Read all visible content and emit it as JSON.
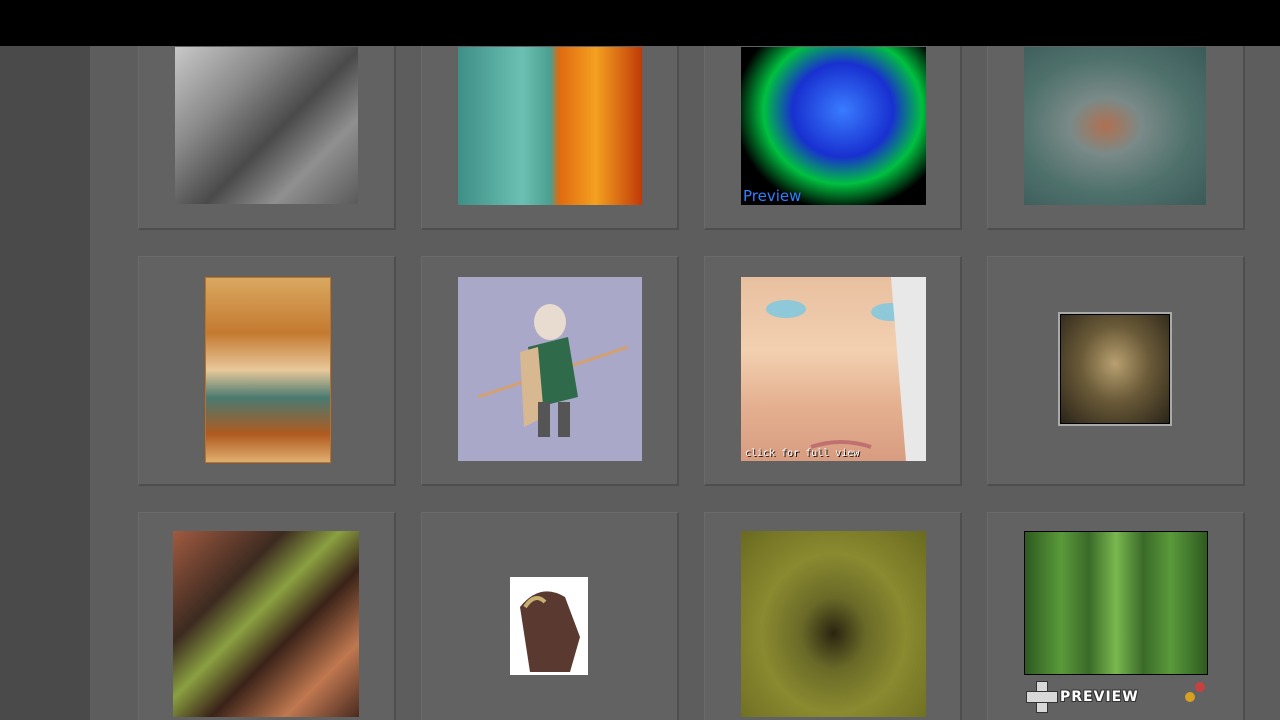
{
  "gallery": {
    "items": [
      {
        "name": "stone-giant-artwork",
        "caption": ""
      },
      {
        "name": "ice-fire-faces-artwork",
        "caption": ""
      },
      {
        "name": "ansi-helmet-artwork",
        "caption": "Preview"
      },
      {
        "name": "viking-ship-artwork",
        "caption": ""
      },
      {
        "name": "tower-map-artwork",
        "caption": ""
      },
      {
        "name": "spear-warrior-artwork",
        "caption": ""
      },
      {
        "name": "woman-face-artwork",
        "caption": "click for full view"
      },
      {
        "name": "skull-totem-artwork",
        "caption": ""
      },
      {
        "name": "jungle-vines-artwork",
        "caption": ""
      },
      {
        "name": "claw-hand-artwork",
        "caption": ""
      },
      {
        "name": "green-eye-artwork",
        "caption": ""
      },
      {
        "name": "forest-artwork",
        "caption": "PREVIEW"
      }
    ]
  },
  "colors": {
    "background": "#5d5d5d",
    "sidebar": "#4a4a4a",
    "topbar": "#000000",
    "preview_caption": "#2f7fff"
  }
}
